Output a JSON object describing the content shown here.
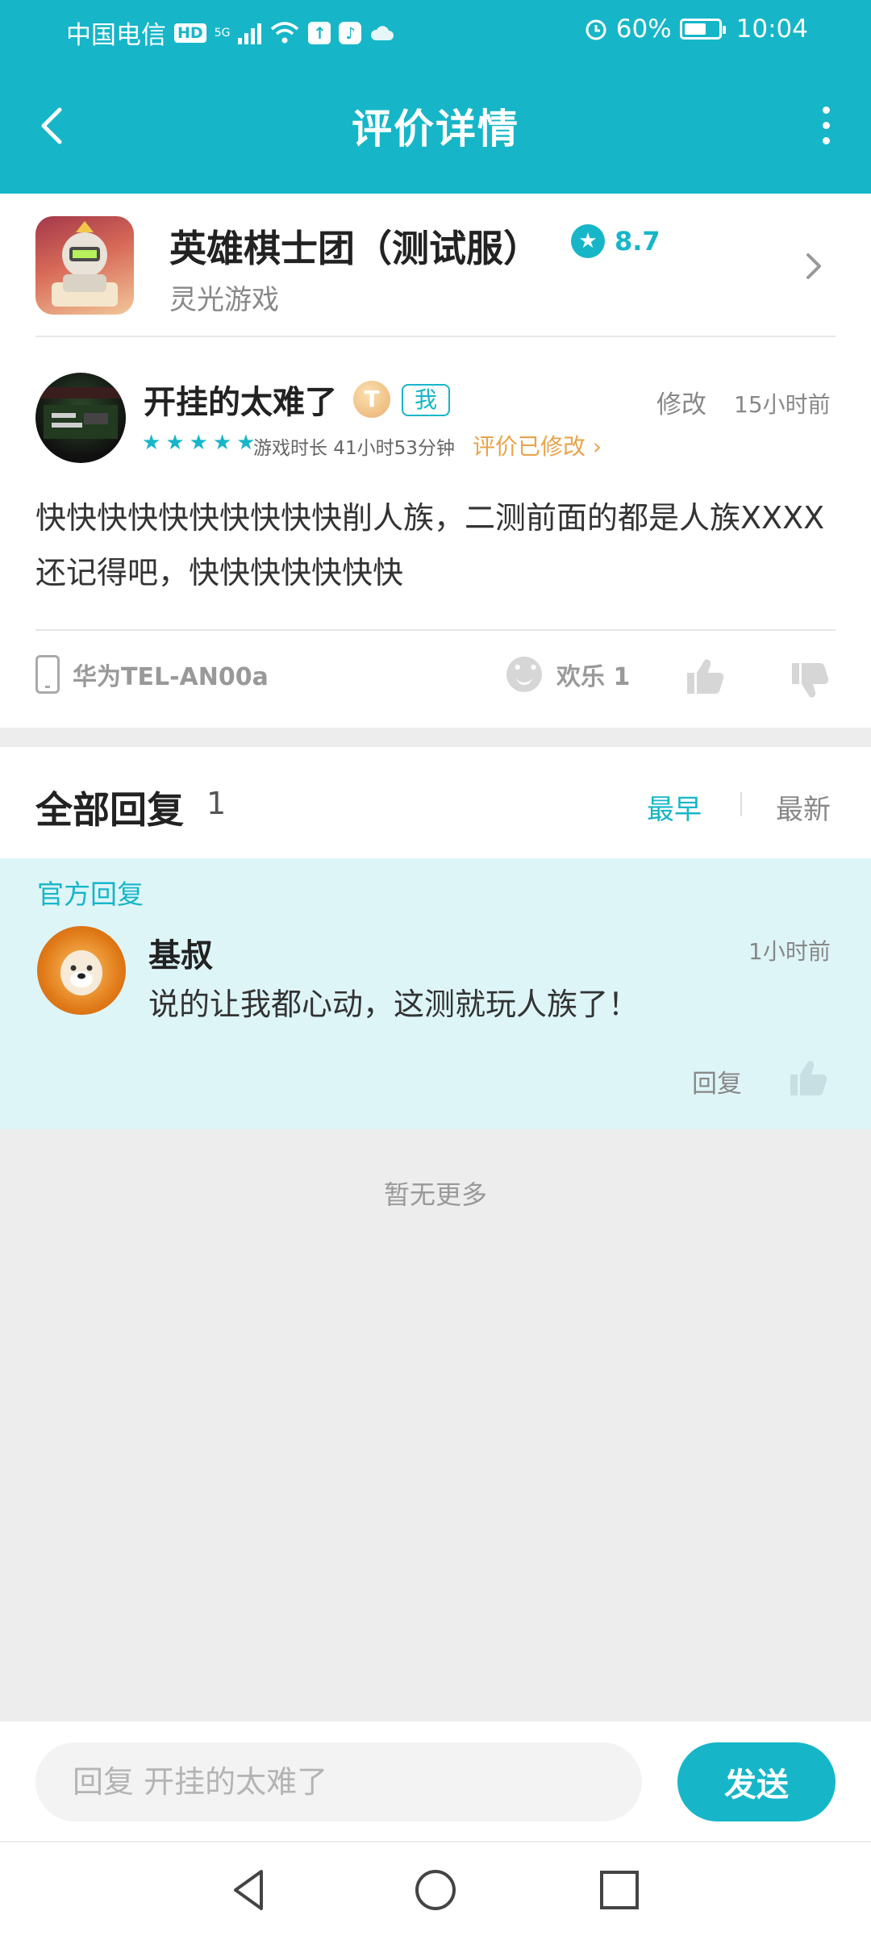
{
  "status_bar": {
    "carrier": "中国电信",
    "hd": "HD",
    "network": "5G",
    "battery": "60%",
    "time": "10:04",
    "icons": [
      "hd-icon",
      "signal-icon",
      "wifi-icon",
      "upload-icon",
      "music-icon",
      "cloud-icon",
      "alarm-icon",
      "battery-icon"
    ]
  },
  "appbar": {
    "title": "评价详情"
  },
  "game": {
    "name": "英雄棋士团（测试服）",
    "rating": "8.7",
    "developer": "灵光游戏"
  },
  "review": {
    "username": "开挂的太难了",
    "level_badge": "T",
    "me_tag": "我",
    "edit_label": "修改",
    "time": "15小时前",
    "stars": 5,
    "playtime": "游戏时长 41小时53分钟",
    "modified": "评价已修改",
    "text": "快快快快快快快快快快削人族，二测前面的都是人族XXXX还记得吧，快快快快快快快",
    "device": "华为TEL-AN00a",
    "reaction": "欢乐 1",
    "accent_color": "#16b6c8"
  },
  "replies": {
    "title": "全部回复",
    "count": "1",
    "sort_earliest": "最早",
    "sort_latest": "最新",
    "official_label": "官方回复",
    "items": [
      {
        "name": "基叔",
        "time": "1小时前",
        "text": "说的让我都心动，这测就玩人族了！",
        "reply_label": "回复"
      }
    ],
    "no_more": "暂无更多"
  },
  "input": {
    "placeholder": "回复 开挂的太难了",
    "send_label": "发送"
  }
}
